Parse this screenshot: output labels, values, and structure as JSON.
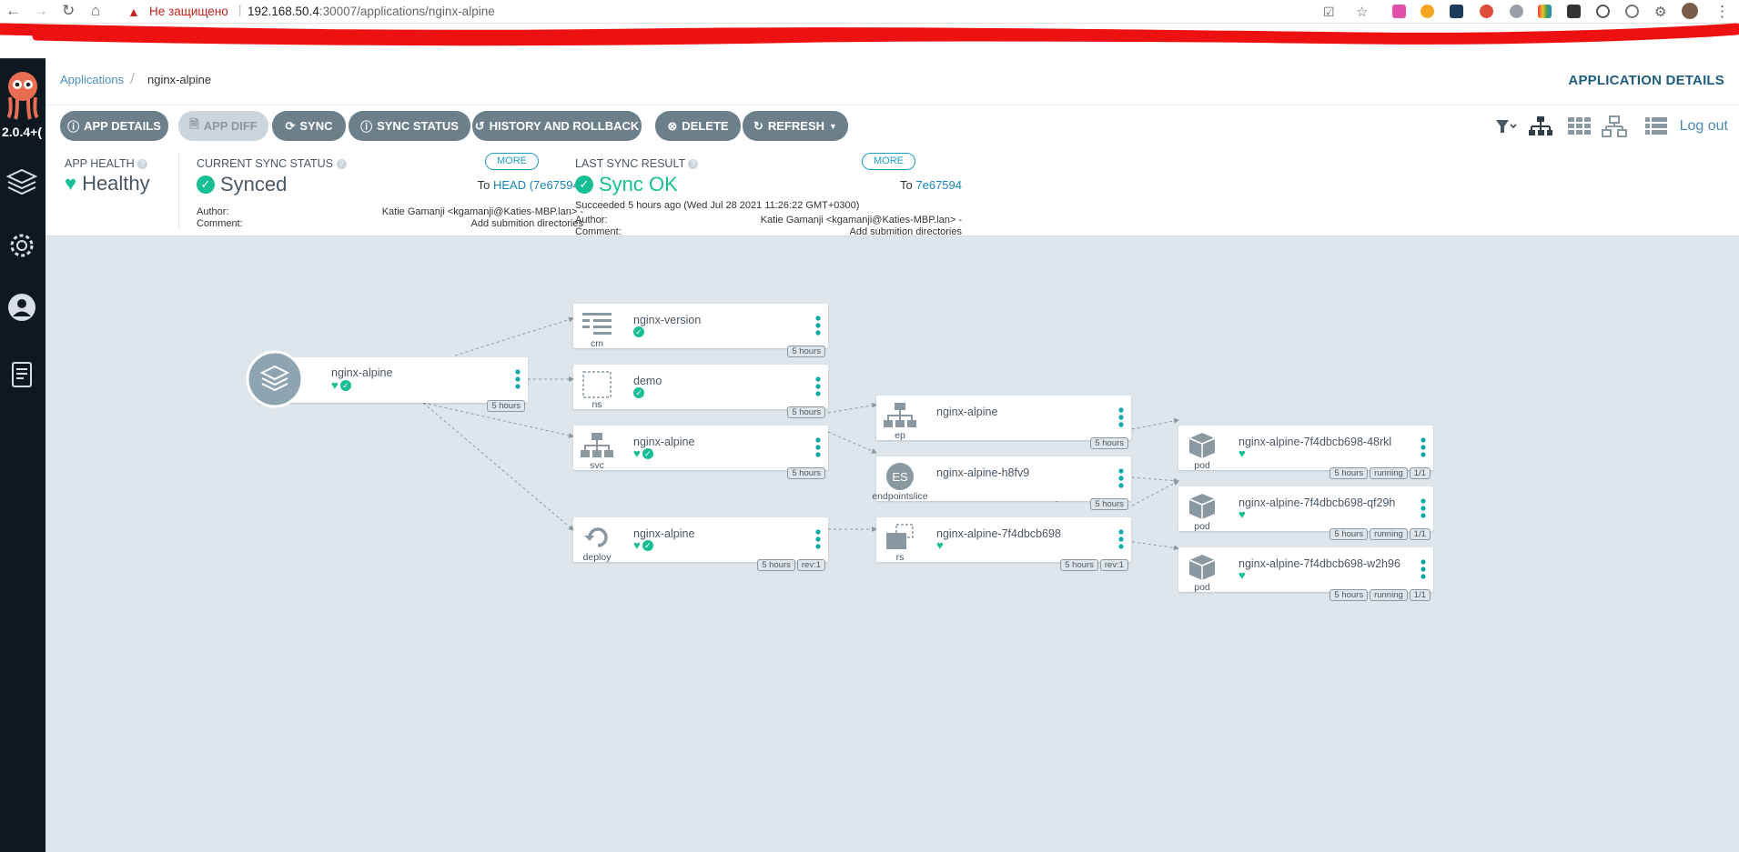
{
  "browser": {
    "security_warning": "Не защищено",
    "url_host": "192.168.50.4",
    "url_path": ":30007/applications/nginx-alpine"
  },
  "sidebar": {
    "version": "2.0.4+("
  },
  "header": {
    "breadcrumb_root": "Applications",
    "breadcrumb_current": "nginx-alpine",
    "page_title": "APPLICATION DETAILS"
  },
  "toolbar": {
    "app_details": "APP DETAILS",
    "app_diff": "APP DIFF",
    "sync": "SYNC",
    "sync_status": "SYNC STATUS",
    "history": "HISTORY AND ROLLBACK",
    "delete": "DELETE",
    "refresh": "REFRESH",
    "logout": "Log out"
  },
  "status": {
    "health_label": "APP HEALTH",
    "health_value": "Healthy",
    "sync_label": "CURRENT SYNC STATUS",
    "sync_value": "Synced",
    "sync_more": "MORE",
    "sync_to": "To",
    "sync_to_rev": "HEAD (7e67594)",
    "sync_author_label": "Author:",
    "sync_author": "Katie Gamanji <kgamanji@Katies-MBP.lan> -",
    "sync_comment_label": "Comment:",
    "sync_comment": "Add submition directories",
    "last_label": "LAST SYNC RESULT",
    "last_value": "Sync OK",
    "last_more": "MORE",
    "last_to": "To",
    "last_to_rev": "7e67594",
    "last_succeeded": "Succeeded 5 hours ago (Wed Jul 28 2021 11:26:22 GMT+0300)",
    "last_author_label": "Author:",
    "last_author": "Katie Gamanji <kgamanji@Katies-MBP.lan> -",
    "last_comment_label": "Comment:",
    "last_comment": "Add submition directories"
  },
  "nodes": {
    "app": {
      "name": "nginx-alpine",
      "age": "5 hours"
    },
    "cm": {
      "kind": "cm",
      "name": "nginx-version",
      "age": "5 hours"
    },
    "ns": {
      "kind": "ns",
      "name": "demo",
      "age": "5 hours"
    },
    "svc": {
      "kind": "svc",
      "name": "nginx-alpine",
      "age": "5 hours"
    },
    "deploy": {
      "kind": "deploy",
      "name": "nginx-alpine",
      "age": "5 hours",
      "rev": "rev:1"
    },
    "ep": {
      "kind": "ep",
      "name": "nginx-alpine",
      "age": "5 hours"
    },
    "es": {
      "kind": "endpointslice",
      "name": "nginx-alpine-h8fv9",
      "age": "5 hours",
      "icon_text": "ES"
    },
    "rs": {
      "kind": "rs",
      "name": "nginx-alpine-7f4dbcb698",
      "age": "5 hours",
      "rev": "rev:1"
    },
    "pod1": {
      "kind": "pod",
      "name": "nginx-alpine-7f4dbcb698-48rkl",
      "age": "5 hours",
      "state": "running",
      "ready": "1/1"
    },
    "pod2": {
      "kind": "pod",
      "name": "nginx-alpine-7f4dbcb698-qf29h",
      "age": "5 hours",
      "state": "running",
      "ready": "1/1"
    },
    "pod3": {
      "kind": "pod",
      "name": "nginx-alpine-7f4dbcb698-w2h96",
      "age": "5 hours",
      "state": "running",
      "ready": "1/1"
    }
  },
  "colors": {
    "healthy": "#18be94",
    "button": "#6d7f8b",
    "sidebar": "#0d1821",
    "link": "#1a84b5"
  }
}
